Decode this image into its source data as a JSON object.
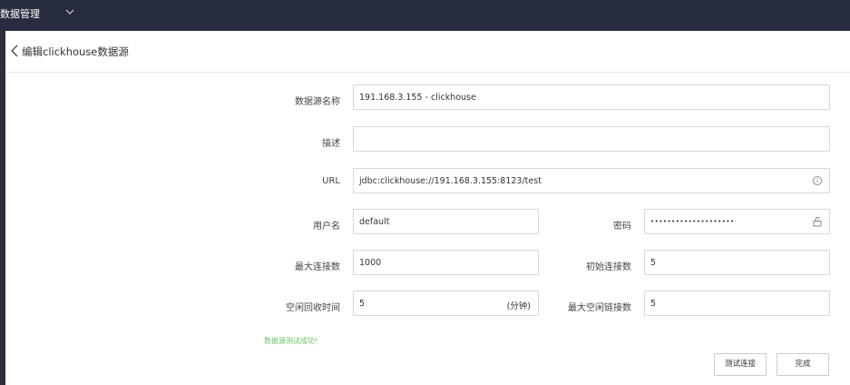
{
  "topbar": {
    "title": "数据管理"
  },
  "header": {
    "title": "编辑clickhouse数据源"
  },
  "form": {
    "name_label": "数据源名称",
    "name_value": "191.168.3.155 - clickhouse",
    "desc_label": "描述",
    "desc_value": "",
    "url_label": "URL",
    "url_value": "jdbc:clickhouse://191.168.3.155:8123/test",
    "user_label": "用户名",
    "user_value": "default",
    "password_label": "密码",
    "password_value": "••••••••••••••••••••",
    "max_conn_label": "最大连接数",
    "max_conn_value": "1000",
    "init_conn_label": "初始连接数",
    "init_conn_value": "5",
    "idle_recycle_label": "空闲回收时间",
    "idle_recycle_value": "5",
    "idle_recycle_unit": "(分钟)",
    "max_idle_label": "最大空闲链接数",
    "max_idle_value": "5"
  },
  "status": {
    "message": "数据源测试成功!"
  },
  "actions": {
    "test_label": "测试连接",
    "done_label": "完成"
  },
  "icons": {
    "chevron": "chevron-down-icon",
    "back": "chevron-left-icon",
    "info": "info-icon",
    "lock": "unlock-icon"
  }
}
